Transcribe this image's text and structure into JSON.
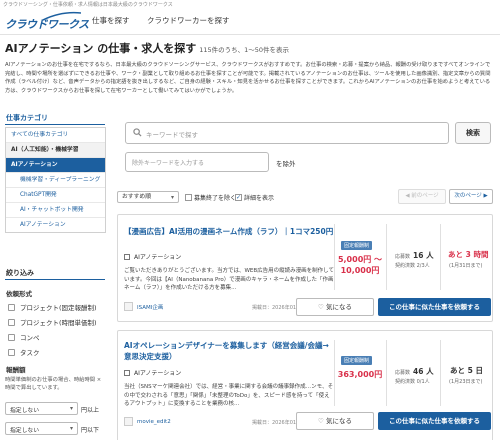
{
  "header": {
    "top_note": "クラウドソーシング・仕事依頼・求人情報は日本最大級のクラウドワークス",
    "logo_text": "クラウドワークス",
    "nav": {
      "find_job": "仕事を探す",
      "find_worker": "クラウドワーカーを探す"
    }
  },
  "page": {
    "title": "AIアノテーション の仕事・求人を探す",
    "count": "115件のうち、1〜50件を表示",
    "intro": "AIアノテーションのお仕事を在宅でするなら、日本最大級のクラウドソーシングサービス、クラウドワークスがおすすめです。お仕事の検索・応募・提案から納品、報酬の受け取りまですべてオンラインで完結し、時間や場所を選ばずにできるお仕事や、ワーク・副業として取り組めるお仕事を探すことが可能です。掲載されているアノテーションのお仕事は、ツールを使用した画像識別、指定文章からの質問作成（ラベル付け）など、音声データからの指定語を抜き出しするなど、ご自身の経験・スキル・知見を活かせるお仕事を探すことができます。これからAIアノテーションのお仕事を始めようと考えている方は、クラウドワークスからお仕事を探して在宅ワーカーとして働いてみてはいかがでしょうか。"
  },
  "sidebar": {
    "category_head": "仕事カテゴリ",
    "categories": [
      "すべての仕事カテゴリ",
      "AI（人工知能）・機械学習",
      "AIアノテーション",
      "機械学習・ディープラーニング",
      "ChatGPT開発",
      "AI・チャットボット開発",
      "AIアノテーション"
    ],
    "filter_head": "絞り込み",
    "request_type_head": "依頼形式",
    "request_types": [
      "プロジェクト(固定報酬制)",
      "プロジェクト(時間単価制)",
      "コンペ",
      "タスク"
    ],
    "reward_head": "報酬額",
    "reward_note": "時間単価制のお仕事の場合、時給時間 × 時間で算出しています。",
    "reward_min_placeholder": "指定しない",
    "reward_min_suffix": "円以上",
    "reward_max_placeholder": "指定しない",
    "reward_max_suffix": "円以下"
  },
  "search": {
    "keyword_placeholder": "キーワードで探す",
    "search_button": "検索",
    "exclude_placeholder": "除外キーワードを入力する",
    "exclude_label": "を除外"
  },
  "sort": {
    "selected": "おすすめ順",
    "hide_closed": "募集終了を除く",
    "show_details": "詳細を表示",
    "details_checked": "✓",
    "prev": "◀ 前のページ",
    "next": "次のページ ▶"
  },
  "jobs": [
    {
      "title": "【漫画広告】AI活用の漫画ネーム作成（ラフ）｜1コマ250円",
      "category": "AIアノテーション",
      "description": "ご覧いただきありがとうございます。当方では、WEB広告用の縦読み漫画を制作しています。今回は【AI（Nanobanana Pro）で漫画のキャラ・ネームを作成した「作画ネーム（ラフ）」を作成いただける方を募集...",
      "client": "ISAMI企画",
      "posted": "掲載日：2026年01月19日",
      "tag": "固定報酬制",
      "price_top": "5,000円 〜",
      "price_bottom": "10,000円",
      "applicants_label": "応募数",
      "applicants": "16 人",
      "contract_label": "契約済数 2/3人",
      "remain": "あと 3 時間",
      "deadline": "(1月31日まで)",
      "remain_color": "#d9304a",
      "fav_label": "気になる",
      "apply_label": "この仕事に似た仕事を依頼する"
    },
    {
      "title": "AIオペレーションデザイナーを募集します（経営会議/会議→意思決定支援）",
      "category": "AIアノテーション",
      "description": "当社（SNSマーケ関連会社）では、経営・事業に関する会議の議事録作成…ンモ、その中で交わされる「意思」「関係」「未整理のToDo」を、スピード感を持って「使えるアウトプット」に変換することを業務の核...",
      "client": "movie_edit2",
      "posted": "掲載日：2026年01月15日",
      "tag": "固定報酬制",
      "price_top": "363,000円",
      "price_bottom": "",
      "applicants_label": "応募数",
      "applicants": "46 人",
      "contract_label": "契約済数 0/1人",
      "remain": "あと 5 日",
      "deadline": "(1月23日まで)",
      "remain_color": "#333333",
      "fav_label": "気になる",
      "apply_label": "この仕事に似た仕事を依頼する"
    }
  ]
}
